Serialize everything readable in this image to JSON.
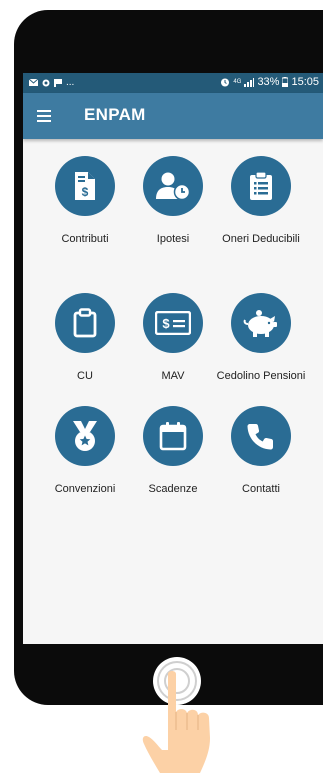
{
  "status_bar": {
    "left_icons": [
      "mail-icon",
      "circle-icon",
      "flag-icon",
      "more-dots"
    ],
    "dots": "...",
    "alarm_icon": "alarm-icon",
    "network": "4G",
    "signal_icon": "signal-icon",
    "battery": "33%",
    "time": "15:05"
  },
  "app_bar": {
    "title": "ENPAM",
    "menu_icon": "menu-icon"
  },
  "tiles": [
    {
      "label": "Contributi",
      "icon": "dollar-document-icon"
    },
    {
      "label": "Ipotesi",
      "icon": "user-clock-icon"
    },
    {
      "label": "Oneri Deducibili",
      "icon": "clipboard-list-icon"
    },
    {
      "label": "CU",
      "icon": "clipboard-icon"
    },
    {
      "label": "MAV",
      "icon": "money-bill-icon"
    },
    {
      "label": "Cedolino Pensioni",
      "icon": "piggy-bank-icon"
    },
    {
      "label": "Convenzioni",
      "icon": "medal-icon"
    },
    {
      "label": "Scadenze",
      "icon": "calendar-icon"
    },
    {
      "label": "Contatti",
      "icon": "phone-icon"
    }
  ],
  "colors": {
    "status_bar": "#245a78",
    "app_bar": "#3e7ba1",
    "icon_circle": "#2a6c94",
    "screen_background": "#f6f6f6",
    "phone_body": "#0b0b0b"
  }
}
